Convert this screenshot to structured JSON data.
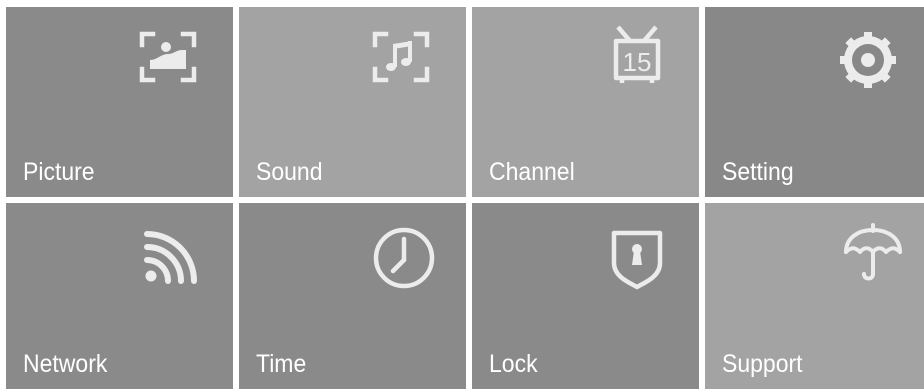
{
  "colors": {
    "picture": "#8a8a8a",
    "sound": "#a3a3a3",
    "channel": "#a3a3a3",
    "setting": "#888888",
    "network": "#8a8a8a",
    "time": "#8a8a8a",
    "lock": "#8a8a8a",
    "support": "#a3a3a3",
    "icon": "#ececec",
    "label": "#ffffff"
  },
  "tiles": [
    {
      "label": "Picture",
      "icon": "picture-icon"
    },
    {
      "label": "Sound",
      "icon": "sound-icon"
    },
    {
      "label": "Channel",
      "icon": "channel-icon"
    },
    {
      "label": "Setting",
      "icon": "setting-icon"
    },
    {
      "label": "Network",
      "icon": "network-icon"
    },
    {
      "label": "Time",
      "icon": "time-icon"
    },
    {
      "label": "Lock",
      "icon": "lock-icon"
    },
    {
      "label": "Support",
      "icon": "support-icon"
    }
  ],
  "channel_icon_number": "15"
}
